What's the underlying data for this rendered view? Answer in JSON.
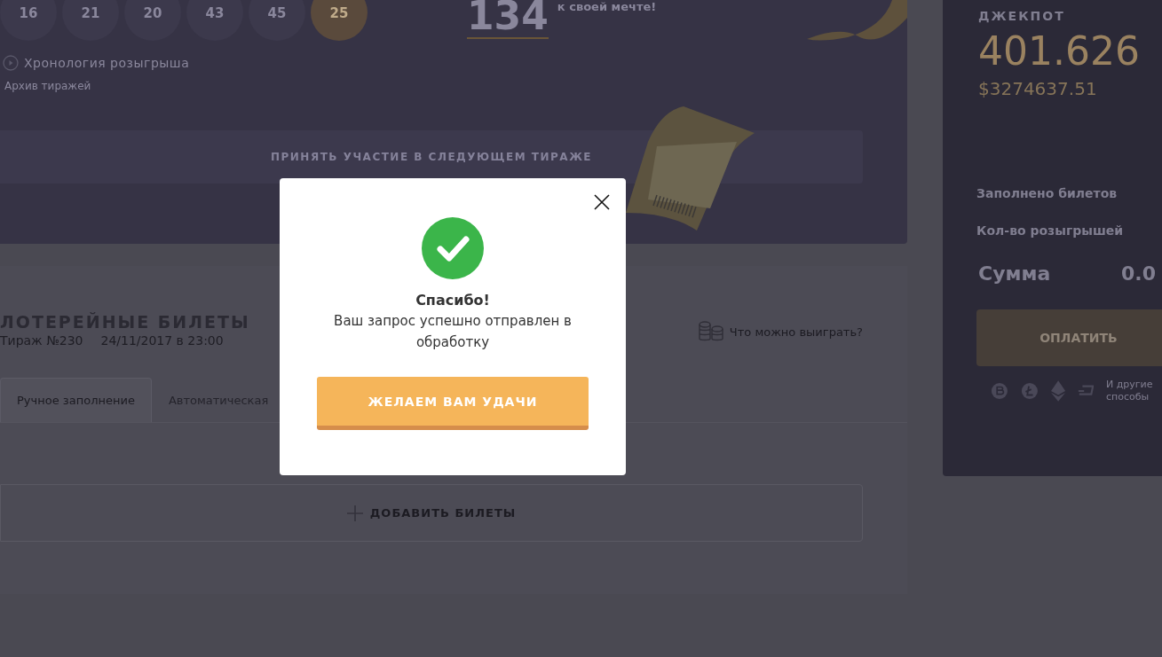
{
  "draw": {
    "balls": [
      {
        "number": "16",
        "selected": false
      },
      {
        "number": "21",
        "selected": false
      },
      {
        "number": "20",
        "selected": false
      },
      {
        "number": "43",
        "selected": false
      },
      {
        "number": "45",
        "selected": false
      },
      {
        "number": "25",
        "selected": true
      }
    ],
    "counter": "134",
    "counter_caption": "к своей мечте!",
    "chronology_link": "Хронология розыгрыша",
    "archive_link": "Архив тиражей",
    "join_button": "ПРИНЯТЬ УЧАСТИЕ В СЛЕДУЮЩЕМ ТИРАЖЕ"
  },
  "tickets": {
    "title": "ЛОТЕРЕЙНЫЕ БИЛЕТЫ",
    "draw_number": "Тираж №230",
    "draw_date": "24/11/2017 в 23:00",
    "prizes_link": "Что можно выиграть?",
    "tabs": [
      {
        "label": "Ручное заполнение",
        "selected": true
      },
      {
        "label": "Автоматическая",
        "selected": false
      }
    ],
    "add_button": "ДОБАВИТЬ БИЛЕТЫ"
  },
  "jackpot": {
    "label": "ДЖЕКПОТ",
    "amount": "401.626",
    "usd": "$3274637.51",
    "rows": [
      "Заполнено билетов",
      "Кол-во розыгрышей"
    ],
    "sum_label": "Сумма",
    "sum_value": "0.0",
    "pay_button": "ОПЛАТИТЬ",
    "other_methods": "И другие способы"
  },
  "modal": {
    "title": "Спасибо!",
    "message": "Ваш запрос успешно отправлен в обработку",
    "button": "ЖЕЛАЕМ ВАМ УДАЧИ"
  }
}
